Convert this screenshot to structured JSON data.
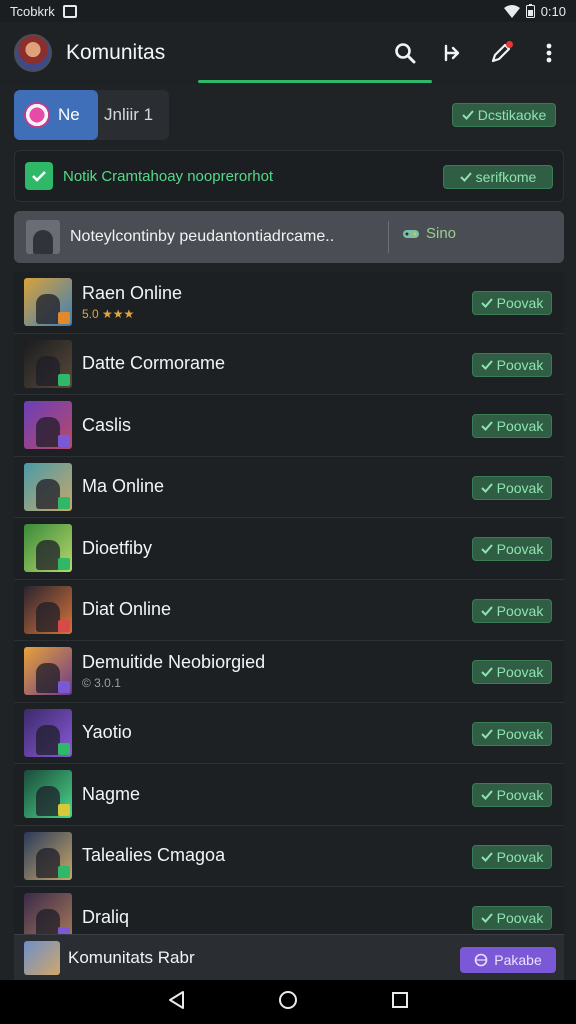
{
  "status_bar": {
    "left_text": "Tcobkrk",
    "time": "0:10"
  },
  "app_bar": {
    "title": "Komunitas"
  },
  "online_chip": {
    "prefix": "Ne",
    "label": "Jnliir 1",
    "verify_label": "Dcstikaoke"
  },
  "notice": {
    "text": "Notik Cramtahoay nooprerorhot",
    "button_label": "serifkome"
  },
  "info_bar": {
    "text": "Noteylcontinby peudantontiadrcame..",
    "tag_label": "Sino"
  },
  "games": [
    {
      "name": "Raen Online",
      "sub": "5.0 ★★★",
      "sub_style": "gold",
      "button": "Poovak",
      "colors": [
        "#d9a23a",
        "#3f7fb8"
      ],
      "badge": "#e08a2a"
    },
    {
      "name": "Datte Cormorame",
      "sub": "",
      "sub_style": "",
      "button": "Poovak",
      "colors": [
        "#1a1c1f",
        "#5a4a3a"
      ],
      "badge": "#2eb868"
    },
    {
      "name": "Caslis",
      "sub": "",
      "sub_style": "",
      "button": "Poovak",
      "colors": [
        "#6a3fb8",
        "#b84a6a"
      ],
      "badge": "#7b58d6"
    },
    {
      "name": "Ma Online",
      "sub": "",
      "sub_style": "",
      "button": "Poovak",
      "colors": [
        "#4a9aa8",
        "#c8a86a"
      ],
      "badge": "#2eb868"
    },
    {
      "name": "Dioetfiby",
      "sub": "",
      "sub_style": "",
      "button": "Poovak",
      "colors": [
        "#3a8a3a",
        "#b8d86a"
      ],
      "badge": "#2eb868"
    },
    {
      "name": "Diat Online",
      "sub": "",
      "sub_style": "",
      "button": "Poovak",
      "colors": [
        "#2a2430",
        "#d8743a"
      ],
      "badge": "#d84a4a"
    },
    {
      "name": "Demuitide Neobiorgied",
      "sub": "© 3.0.1",
      "sub_style": "gray",
      "button": "Poovak",
      "colors": [
        "#e8a23a",
        "#6a3a8a"
      ],
      "badge": "#7b58d6"
    },
    {
      "name": "Yaotio",
      "sub": "",
      "sub_style": "",
      "button": "Poovak",
      "colors": [
        "#3a2a6a",
        "#8a5ad8"
      ],
      "badge": "#2eb868"
    },
    {
      "name": "Nagme",
      "sub": "",
      "sub_style": "",
      "button": "Poovak",
      "colors": [
        "#1a4a3a",
        "#4ad88a"
      ],
      "badge": "#d8c83a"
    },
    {
      "name": "Talealies Cmagoa",
      "sub": "",
      "sub_style": "",
      "button": "Poovak",
      "colors": [
        "#2a3a5a",
        "#c8a86a"
      ],
      "badge": "#2eb868"
    },
    {
      "name": "Draliq",
      "sub": "",
      "sub_style": "",
      "button": "Poovak",
      "colors": [
        "#3a2a4a",
        "#a87a5a"
      ],
      "badge": "#7b58d6"
    }
  ],
  "bottom_bar": {
    "title": "Komunitats Rabr",
    "button_label": "Pakabe"
  },
  "colors": {
    "accent_green": "#2eb868",
    "verify_bg": "#2f5e44",
    "purple": "#7b58d6"
  }
}
